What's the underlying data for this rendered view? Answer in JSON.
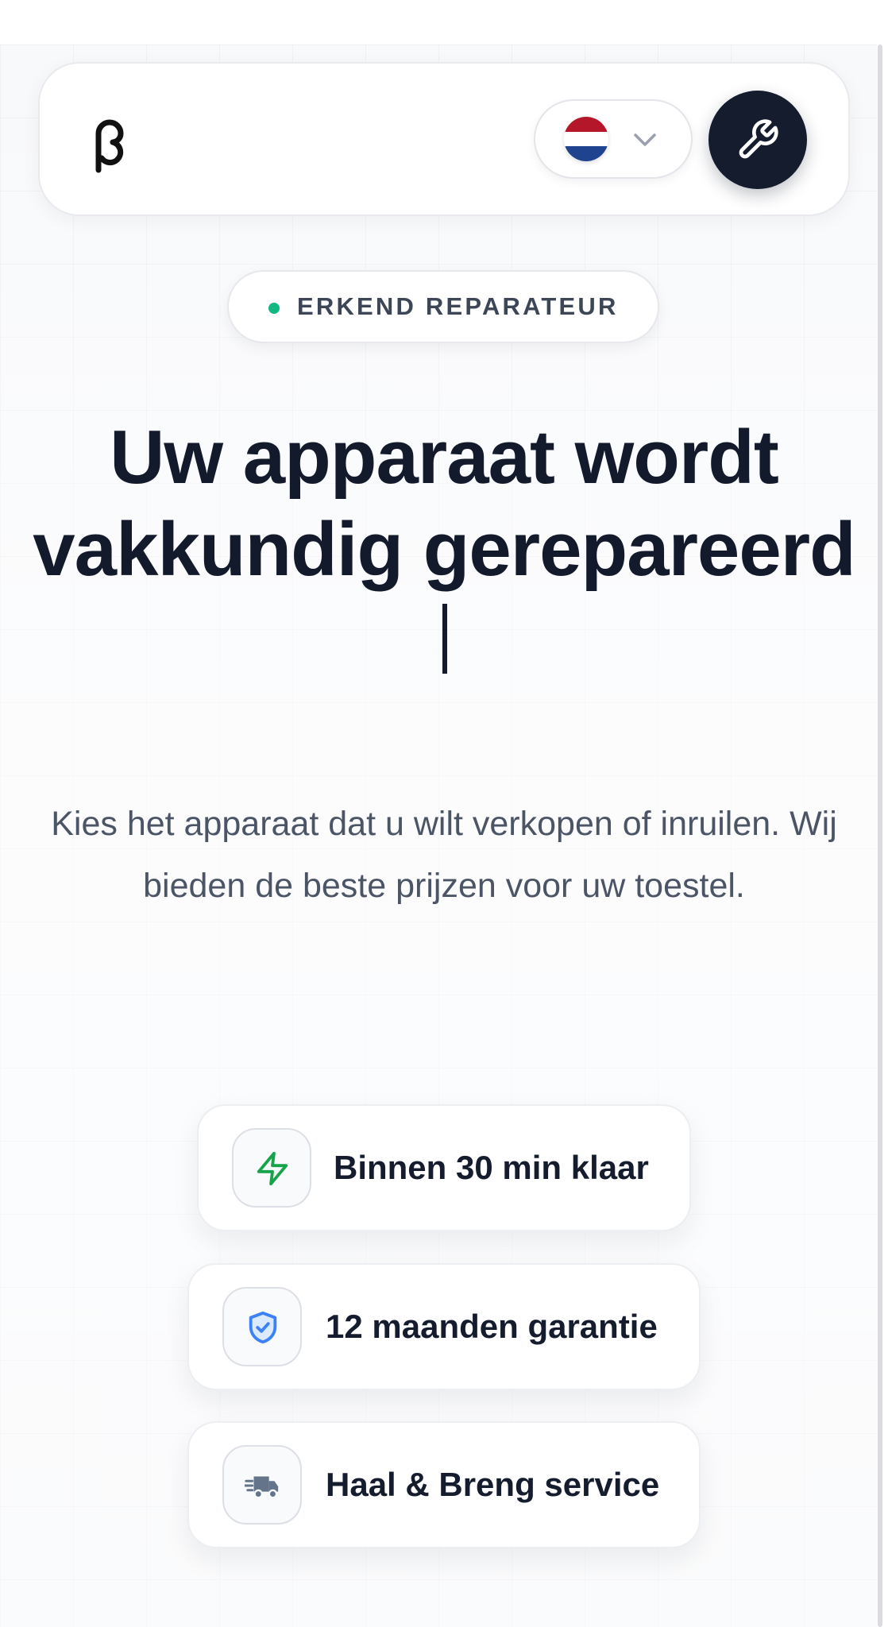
{
  "header": {
    "logo_icon": "brand-logo",
    "language": {
      "selected": "Nederlands",
      "flag_icon": "flag-netherlands",
      "chevron_icon": "chevron-down-icon"
    },
    "repair_button_icon": "wrench-icon"
  },
  "badge": {
    "text": "ERKEND REPARATEUR",
    "dot_color": "#10b981"
  },
  "hero": {
    "headline": "Uw apparaat wordt vakkundig gerepareerd",
    "subtitle": "Kies het apparaat dat u wilt verkopen of inruilen. Wij bieden de beste prijzen voor uw toestel."
  },
  "features": [
    {
      "label": "Binnen 30 min klaar",
      "icon": "lightning-icon",
      "color": "#16a34a"
    },
    {
      "label": "12 maanden garantie",
      "icon": "shield-check-icon",
      "color": "#3b82f6"
    },
    {
      "label": "Haal & Breng service",
      "icon": "truck-icon",
      "color": "#64748b"
    }
  ],
  "colors": {
    "primary_dark": "#141c2e",
    "text_muted": "#4b5566",
    "background": "#f8f9fb"
  }
}
